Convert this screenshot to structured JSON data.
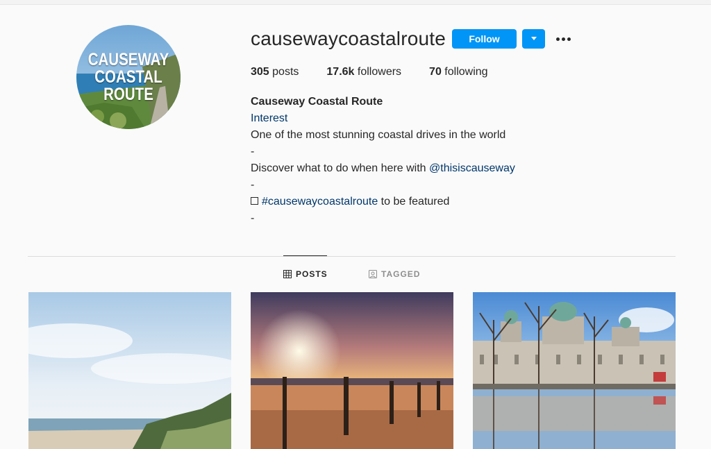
{
  "profile": {
    "avatar_text": [
      "CAUSEWAY",
      "COASTAL",
      "ROUTE"
    ],
    "username": "causewaycoastalroute",
    "follow_label": "Follow",
    "more_icon": "more-horizontal-icon"
  },
  "stats": {
    "posts_count": "305",
    "posts_label": "posts",
    "followers_count": "17.6k",
    "followers_label": "followers",
    "following_count": "70",
    "following_label": "following"
  },
  "bio": {
    "full_name": "Causeway Coastal Route",
    "category": "Interest",
    "line1": "One of the most stunning coastal drives in the world",
    "dash1": "-",
    "line2_prefix": "Discover what to do when here with ",
    "line2_mention": "@thisiscauseway",
    "dash2": "-",
    "line3_hashtag": "#causewaycoastalroute",
    "line3_suffix": " to be featured",
    "dash3": "-"
  },
  "tabs": {
    "posts": "POSTS",
    "tagged": "TAGGED",
    "active": "posts"
  },
  "colors": {
    "accent": "#0095f6",
    "link": "#00376b",
    "background": "#fafafa"
  }
}
